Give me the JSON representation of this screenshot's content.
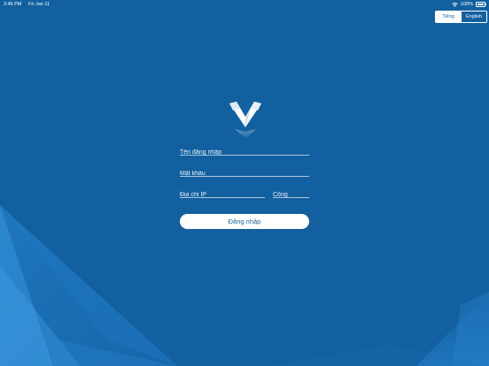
{
  "status_bar": {
    "time": "3:46 PM",
    "date": "Fri Jan 11",
    "battery_percent": "100%"
  },
  "language_switch": {
    "vietnamese_label": "Tiếng Việt",
    "english_label": "English",
    "selected": "Tiếng Việt"
  },
  "login_form": {
    "username": {
      "placeholder": "Tên đăng nhập",
      "value": ""
    },
    "password": {
      "placeholder": "Mật khẩu",
      "value": ""
    },
    "ip_address": {
      "placeholder": "Địa chỉ IP",
      "value": ""
    },
    "port": {
      "placeholder": "Cổng",
      "value": ""
    },
    "submit_label": "Đăng nhập"
  },
  "colors": {
    "background": "#12609f",
    "accent_light": "#2b8ad6",
    "button_text": "#1b5f96"
  },
  "icons": {
    "logo": "v-logo-icon",
    "wifi": "wifi-icon",
    "battery": "battery-icon"
  }
}
